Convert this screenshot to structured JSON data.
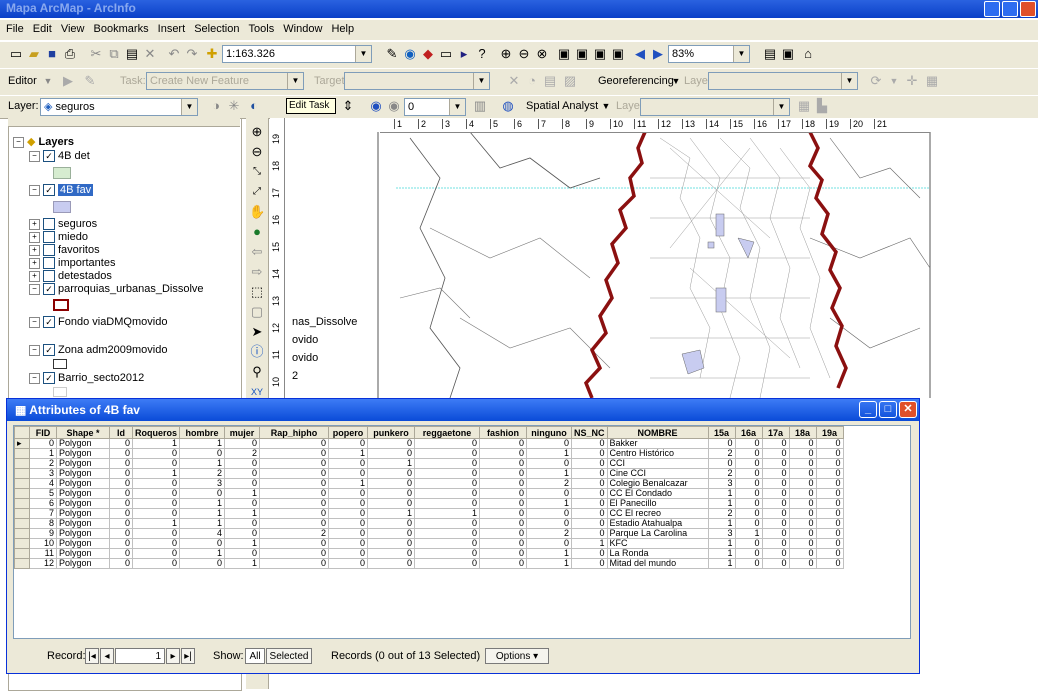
{
  "window": {
    "title": "Mapa ArcMap - ArcInfo"
  },
  "menu": [
    "File",
    "Edit",
    "View",
    "Bookmarks",
    "Insert",
    "Selection",
    "Tools",
    "Window",
    "Help"
  ],
  "standard_toolbar": {
    "scale": "1:163.326",
    "zoom": "83%"
  },
  "editor_toolbar": {
    "editor": "Editor",
    "task_label": "Task:",
    "task_value": "Create New Feature",
    "target_label": "Target:",
    "georef_label": "Georeferencing",
    "layer_label": "Layer:"
  },
  "layer_toolbar": {
    "layer_label": "Layer:",
    "layer_value": "seguros",
    "tooltip": "Edit Task",
    "transparency": "0",
    "spatial_analyst": "Spatial Analyst",
    "layer2_label": "Layer:"
  },
  "toc": {
    "root": "Layers",
    "items": [
      {
        "label": "4B det",
        "checked": "✓",
        "expanded": "−",
        "swatch": "#d6ecd0"
      },
      {
        "label": "4B fav",
        "checked": "✓",
        "expanded": "−",
        "swatch": "#c8ccf0",
        "selected": true
      },
      {
        "label": "seguros",
        "checked": "",
        "expanded": "+"
      },
      {
        "label": "miedo",
        "checked": "",
        "expanded": "+"
      },
      {
        "label": "favoritos",
        "checked": "",
        "expanded": "+"
      },
      {
        "label": "importantes",
        "checked": "",
        "expanded": "+"
      },
      {
        "label": "detestados",
        "checked": "",
        "expanded": "+"
      },
      {
        "label": "parroquias_urbanas_Dissolve",
        "checked": "✓",
        "expanded": "−"
      },
      {
        "label": "Fondo viaDMQmovido",
        "checked": "✓",
        "expanded": "−"
      },
      {
        "label": "Zona adm2009movido",
        "checked": "✓",
        "expanded": "−"
      },
      {
        "label": "Barrio_secto2012",
        "checked": "✓",
        "expanded": "−"
      }
    ]
  },
  "map": {
    "ruler_h": [
      "1",
      "2",
      "3",
      "4",
      "5",
      "6",
      "7",
      "8",
      "9",
      "10",
      "11",
      "12",
      "13",
      "14",
      "15",
      "16",
      "17",
      "18",
      "19",
      "20",
      "21"
    ],
    "ruler_v": [
      "19",
      "18",
      "17",
      "16",
      "15",
      "14",
      "13",
      "12",
      "11",
      "10"
    ],
    "legend_fragments": [
      "nas_Dissolve",
      "ovido",
      "ovido",
      "2"
    ]
  },
  "attributes": {
    "title": "Attributes of 4B fav",
    "columns": [
      "FID",
      "Shape *",
      "Id",
      "Roqueros",
      "hombre",
      "mujer",
      "Rap_hipho",
      "popero",
      "punkero",
      "reggaetone",
      "fashion",
      "ninguno",
      "NS_NC",
      "NOMBRE",
      "15a",
      "16a",
      "17a",
      "18a",
      "19a"
    ],
    "rows": [
      [
        "0",
        "Polygon",
        "0",
        "1",
        "1",
        "0",
        "0",
        "0",
        "0",
        "0",
        "0",
        "0",
        "0",
        "Bakker",
        "0",
        "0",
        "0",
        "0",
        "0"
      ],
      [
        "1",
        "Polygon",
        "0",
        "0",
        "0",
        "2",
        "0",
        "1",
        "0",
        "0",
        "0",
        "1",
        "0",
        "Centro Histórico",
        "2",
        "0",
        "0",
        "0",
        "0"
      ],
      [
        "2",
        "Polygon",
        "0",
        "0",
        "1",
        "0",
        "0",
        "0",
        "1",
        "0",
        "0",
        "0",
        "0",
        "CCI",
        "0",
        "0",
        "0",
        "0",
        "0"
      ],
      [
        "3",
        "Polygon",
        "0",
        "1",
        "2",
        "0",
        "0",
        "0",
        "0",
        "0",
        "0",
        "1",
        "0",
        "Cine CCI",
        "2",
        "0",
        "0",
        "0",
        "0"
      ],
      [
        "4",
        "Polygon",
        "0",
        "0",
        "3",
        "0",
        "0",
        "1",
        "0",
        "0",
        "0",
        "2",
        "0",
        "Colegio Benalcazar",
        "3",
        "0",
        "0",
        "0",
        "0"
      ],
      [
        "5",
        "Polygon",
        "0",
        "0",
        "0",
        "1",
        "0",
        "0",
        "0",
        "0",
        "0",
        "0",
        "0",
        "CC El Condado",
        "1",
        "0",
        "0",
        "0",
        "0"
      ],
      [
        "6",
        "Polygon",
        "0",
        "0",
        "1",
        "0",
        "0",
        "0",
        "0",
        "0",
        "0",
        "1",
        "0",
        "El Panecillo",
        "1",
        "0",
        "0",
        "0",
        "0"
      ],
      [
        "7",
        "Polygon",
        "0",
        "0",
        "1",
        "1",
        "0",
        "0",
        "1",
        "1",
        "0",
        "0",
        "0",
        "CC El recreo",
        "2",
        "0",
        "0",
        "0",
        "0"
      ],
      [
        "8",
        "Polygon",
        "0",
        "1",
        "1",
        "0",
        "0",
        "0",
        "0",
        "0",
        "0",
        "0",
        "0",
        "Estadio Atahualpa",
        "1",
        "0",
        "0",
        "0",
        "0"
      ],
      [
        "9",
        "Polygon",
        "0",
        "0",
        "4",
        "0",
        "2",
        "0",
        "0",
        "0",
        "0",
        "2",
        "0",
        "Parque La Carolina",
        "3",
        "1",
        "0",
        "0",
        "0"
      ],
      [
        "10",
        "Polygon",
        "0",
        "0",
        "0",
        "1",
        "0",
        "0",
        "0",
        "0",
        "0",
        "0",
        "1",
        "KFC",
        "1",
        "0",
        "0",
        "0",
        "0"
      ],
      [
        "11",
        "Polygon",
        "0",
        "0",
        "1",
        "0",
        "0",
        "0",
        "0",
        "0",
        "0",
        "1",
        "0",
        "La Ronda",
        "1",
        "0",
        "0",
        "0",
        "0"
      ],
      [
        "12",
        "Polygon",
        "0",
        "0",
        "0",
        "1",
        "0",
        "0",
        "0",
        "0",
        "0",
        "1",
        "0",
        "Mitad del mundo",
        "1",
        "0",
        "0",
        "0",
        "0"
      ]
    ],
    "record_label": "Record:",
    "record_value": "1",
    "show_label": "Show:",
    "show_all": "All",
    "show_selected": "Selected",
    "records_text": "Records (0 out of 13 Selected)",
    "options": "Options"
  }
}
